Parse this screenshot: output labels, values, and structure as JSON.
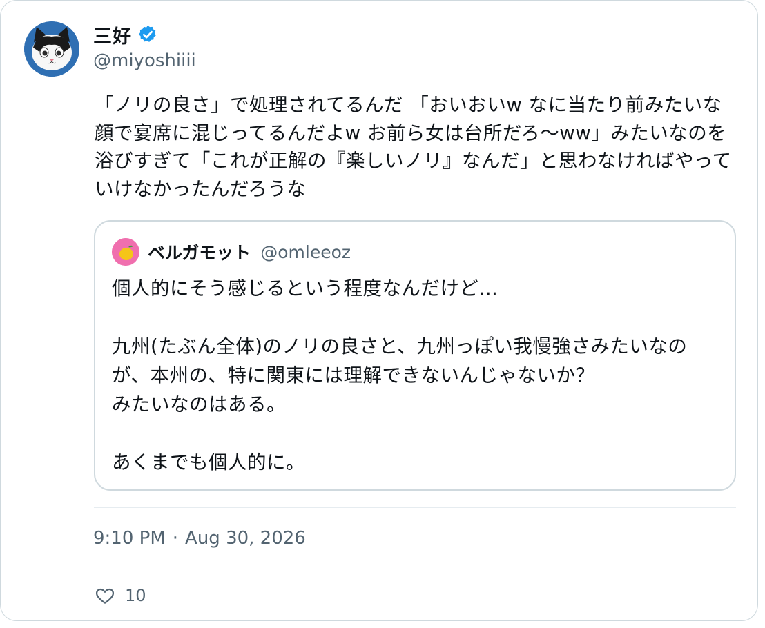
{
  "author": {
    "name": "三好",
    "handle": "@miyoshiiii",
    "verified": true,
    "avatar_icon": "cat-avatar-icon"
  },
  "tweet": {
    "text": "「ノリの良さ」で処理されてるんだ 「おいおいw なに当たり前みたいな顔で宴席に混じってるんだよw お前ら女は台所だろ〜ww」みたいなのを浴びすぎて「これが正解の『楽しいノリ』なんだ」と思わなければやっていけなかったんだろうな"
  },
  "quote": {
    "name": "ベルガモット",
    "handle": "@omleeoz",
    "avatar_icon": "lemon-avatar-icon",
    "text": "個人的にそう感じるという程度なんだけど…\n\n九州(たぶん全体)のノリの良さと、九州っぽい我慢強さみたいなのが、本州の、特に関東には理解できないんじゃないか？\nみたいなのはある。\n\nあくまでも個人的に。"
  },
  "meta": {
    "time": "9:10 PM",
    "separator": "·",
    "date": "Aug 30, 2026"
  },
  "actions": {
    "like_count": "10"
  },
  "colors": {
    "text": "#0f1419",
    "secondary": "#536471",
    "border": "#cfd9de",
    "verified": "#1d9bf0"
  }
}
